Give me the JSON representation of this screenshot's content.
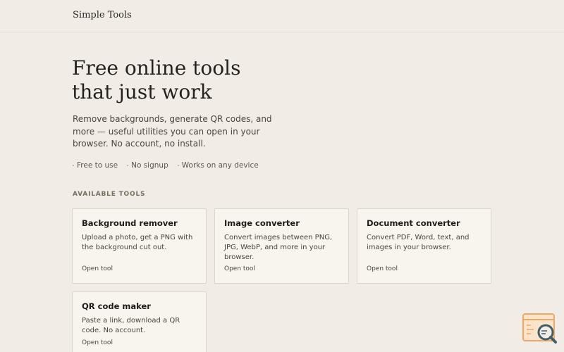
{
  "header": {
    "brand": "Simple Tools"
  },
  "hero": {
    "title_line1": "Free online tools",
    "title_line2": "that just work",
    "description": "Remove backgrounds, generate QR codes, and more — useful utilities you can open in your browser. No account, no install.",
    "features": [
      "Free to use",
      "No signup",
      "Works on any device"
    ]
  },
  "tools": {
    "section_label": "AVAILABLE TOOLS",
    "items": [
      {
        "title": "Background remover",
        "description": "Upload a photo, get a PNG with the background cut out.",
        "link": "Open tool"
      },
      {
        "title": "Image converter",
        "description": "Convert images between PNG, JPG, WebP, and more in your browser.",
        "link": "Open tool"
      },
      {
        "title": "Document converter",
        "description": "Convert PDF, Word, text, and images in your browser.",
        "link": "Open tool"
      },
      {
        "title": "QR code maker",
        "description": "Paste a link, download a QR code. No account.",
        "link": "Open tool"
      }
    ]
  },
  "widget": {
    "icon": "browser-search-icon",
    "colors": {
      "frame": "#f0a865",
      "lens": "#3f5f6b"
    }
  }
}
